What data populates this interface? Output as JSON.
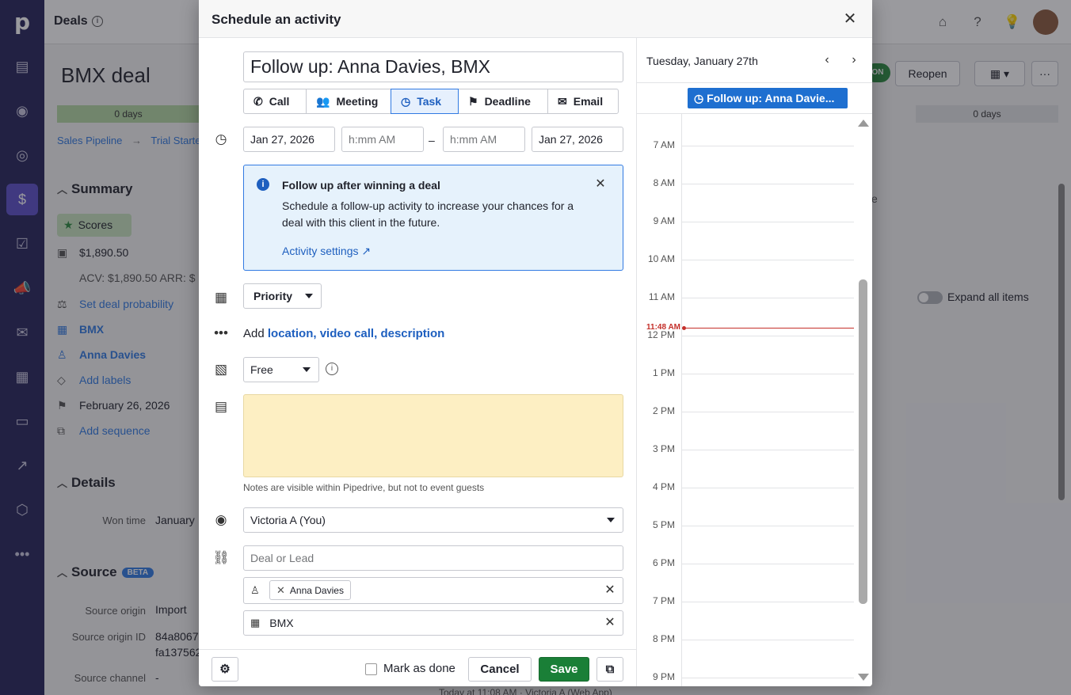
{
  "app": {
    "logo": "p",
    "section_title": "Deals",
    "deal_title": "BMX deal",
    "stage_left": "0 days",
    "stage_right": "0 days",
    "breadcrumb": [
      "Sales Pipeline",
      "→",
      "Trial Started"
    ],
    "won_badge": "ON",
    "reopen_label": "Reopen",
    "summary_title": "Summary",
    "scores_label": "Scores",
    "amount": "$1,890.50",
    "acv_arr": "ACV: $1,890.50   ARR: $",
    "set_probability": "Set deal probability",
    "org": "BMX",
    "person": "Anna Davies",
    "add_labels": "Add labels",
    "close_date": "February 26, 2026",
    "add_sequence": "Add sequence",
    "details_title": "Details",
    "won_time_label": "Won time",
    "won_time_value": "January",
    "source_title": "Source",
    "beta": "BETA",
    "source_origin_label": "Source origin",
    "source_origin_value": "Import",
    "source_origin_id_label": "Source origin ID",
    "source_origin_id_value1": "84a8067",
    "source_origin_id_value2": "fa137562",
    "source_channel_label": "Source channel",
    "source_channel_value": "-",
    "expand_all": "Expand all items",
    "history_text": "Today at 11:08 AM  ·  Victoria A (Web App)",
    "partial_e": "e"
  },
  "modal": {
    "title": "Schedule an activity",
    "subject": "Follow up: Anna Davies, BMX",
    "types": [
      {
        "label": "Call",
        "icon": "phone-icon",
        "glyph": "✆"
      },
      {
        "label": "Meeting",
        "icon": "people-icon",
        "glyph": "👥"
      },
      {
        "label": "Task",
        "icon": "clock-icon",
        "glyph": "◷"
      },
      {
        "label": "Deadline",
        "icon": "flag-icon",
        "glyph": "⚑"
      },
      {
        "label": "Email",
        "icon": "envelope-icon",
        "glyph": "✉"
      }
    ],
    "selected_type": "Task",
    "start_date": "Jan 27, 2026",
    "start_time_placeholder": "h:mm AM",
    "dash": "–",
    "end_time_placeholder": "h:mm AM",
    "end_date": "Jan 27, 2026",
    "banner": {
      "title": "Follow up after winning a deal",
      "body": "Schedule a follow-up activity to increase your chances for a deal with this client in the future.",
      "link": "Activity settings ↗"
    },
    "priority_label": "Priority",
    "add_prefix": "Add",
    "add_links": [
      "location,",
      "video call,",
      "description"
    ],
    "availability": "Free",
    "note_hint": "Notes are visible within Pipedrive, but not to event guests",
    "assignee": "Victoria A (You)",
    "deal_placeholder": "Deal or Lead",
    "participant": "Anna Davies",
    "organization": "BMX",
    "mark_done": "Mark as done",
    "cancel": "Cancel",
    "save": "Save"
  },
  "calendar": {
    "date": "Tuesday, January 27th",
    "event": "Follow up: Anna Davie...",
    "hours": [
      "7 AM",
      "8 AM",
      "9 AM",
      "10 AM",
      "11 AM",
      "12 PM",
      "1 PM",
      "2 PM",
      "3 PM",
      "4 PM",
      "5 PM",
      "6 PM",
      "7 PM",
      "8 PM",
      "9 PM"
    ],
    "now_label": "11:48 AM",
    "now_color": "#c4302b",
    "event_color": "#1e6fd0"
  },
  "colors": {
    "rail": "#26235a",
    "save_green": "#1a7f37",
    "link_blue": "#317ae2",
    "note_yellow": "#fdefc3"
  }
}
